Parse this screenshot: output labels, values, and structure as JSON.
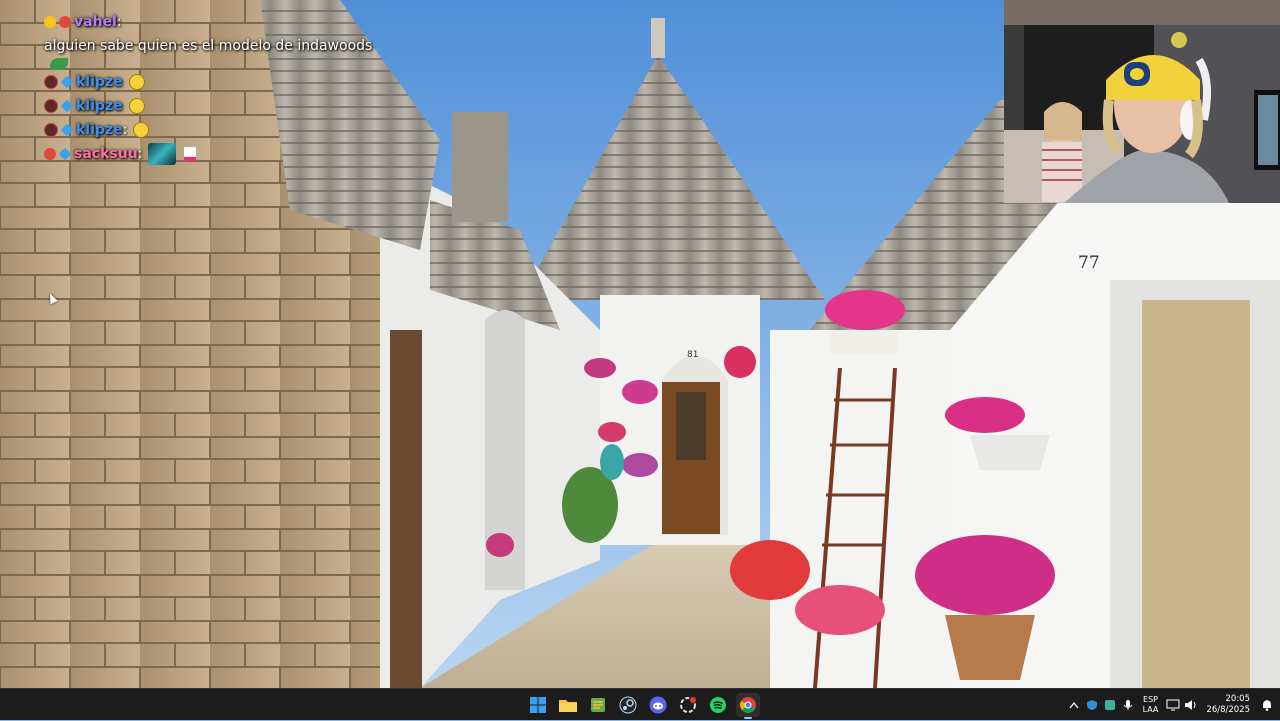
{
  "chat": {
    "messages": [
      {
        "user": "vahel",
        "text": " alguien sabe quien es el modelo de indawoods"
      },
      {
        "user": "klipze"
      },
      {
        "user": "klipze"
      },
      {
        "user": "klipze",
        "suffix": ":"
      },
      {
        "user": "sacksuu",
        "suffix": ":"
      }
    ]
  },
  "taskbar": {
    "apps": [
      "start-icon",
      "file-explorer-icon",
      "notepad-icon",
      "steam-icon",
      "discord-icon",
      "recording-icon",
      "spotify-icon",
      "chrome-icon"
    ],
    "language_line1": "ESP",
    "language_line2": "LAA",
    "time": "20:05",
    "date": "26/8/2025"
  },
  "scene": {
    "door_number_left": "81",
    "door_number_right": "77"
  },
  "colors": {
    "sky": "#87b5e6",
    "stone": "#b49a78",
    "taskbar": "#1c1c1c",
    "user_purple": "#b57cf3",
    "user_blue": "#3e8ff0",
    "user_pink": "#ff6fa5"
  }
}
